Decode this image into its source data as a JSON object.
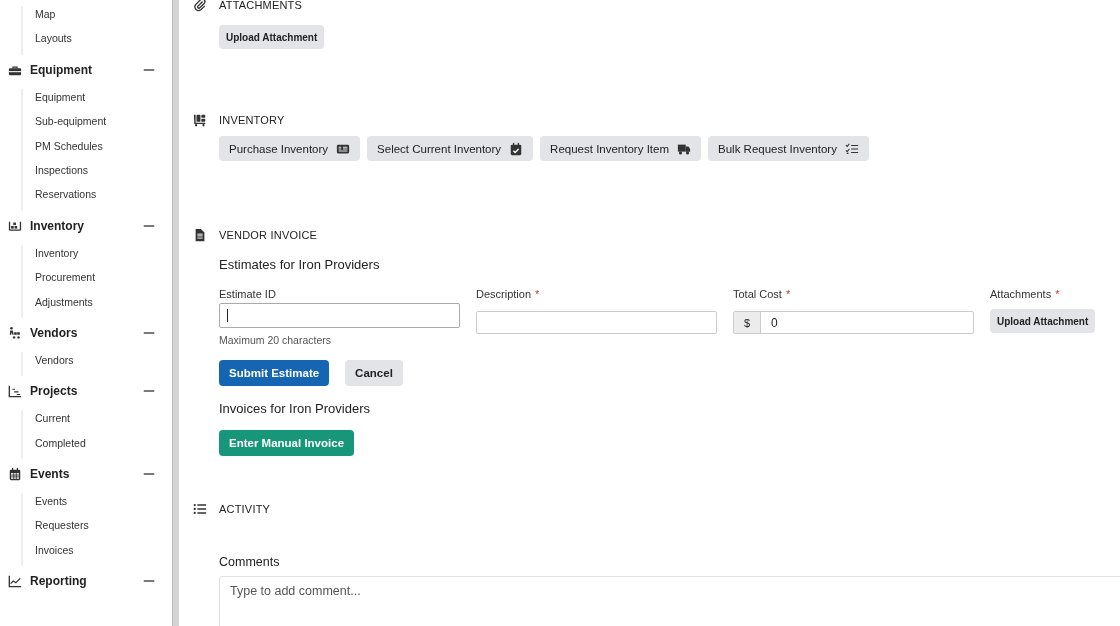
{
  "sidebar": {
    "top_items": [
      "Map",
      "Layouts"
    ],
    "groups": [
      {
        "label": "Equipment",
        "expanded": true,
        "items": [
          "Equipment",
          "Sub-equipment",
          "PM Schedules",
          "Inspections",
          "Reservations"
        ]
      },
      {
        "label": "Inventory",
        "expanded": true,
        "items": [
          "Inventory",
          "Procurement",
          "Adjustments"
        ]
      },
      {
        "label": "Vendors",
        "expanded": true,
        "items": [
          "Vendors"
        ]
      },
      {
        "label": "Projects",
        "expanded": true,
        "items": [
          "Current",
          "Completed"
        ]
      },
      {
        "label": "Events",
        "expanded": true,
        "items": [
          "Events",
          "Requesters",
          "Invoices"
        ]
      },
      {
        "label": "Reporting",
        "expanded": true
      }
    ]
  },
  "attachments": {
    "title": "ATTACHMENTS",
    "button": "Upload Attachment"
  },
  "inventory": {
    "title": "INVENTORY",
    "buttons": [
      {
        "label": "Purchase Inventory"
      },
      {
        "label": "Select Current Inventory"
      },
      {
        "label": "Request Inventory Item"
      },
      {
        "label": "Bulk Request Inventory"
      }
    ]
  },
  "vendor_invoice": {
    "title": "VENDOR INVOICE",
    "estimates_heading": "Estimates for Iron Providers",
    "fields": [
      {
        "kind": "text",
        "label": "Estimate ID",
        "focused": true,
        "help": "Maximum 20 characters"
      },
      {
        "kind": "text",
        "label": "Description",
        "required_mark": "*",
        "focused": false
      },
      {
        "kind": "money",
        "label": "Total Cost",
        "required_mark": "*",
        "prefix": "$",
        "value": "0",
        "focused": false
      },
      {
        "kind": "upload",
        "label": "Attachments",
        "required_mark": "*",
        "button": "Upload Attachment"
      }
    ],
    "submit_button": "Submit Estimate",
    "cancel_button": "Cancel",
    "invoices_heading": "Invoices for Iron Providers",
    "invoice_button": "Enter Manual Invoice"
  },
  "activity": {
    "title": "ACTIVITY",
    "comments_label": "Comments",
    "comment_placeholder": "Type to add comment..."
  }
}
